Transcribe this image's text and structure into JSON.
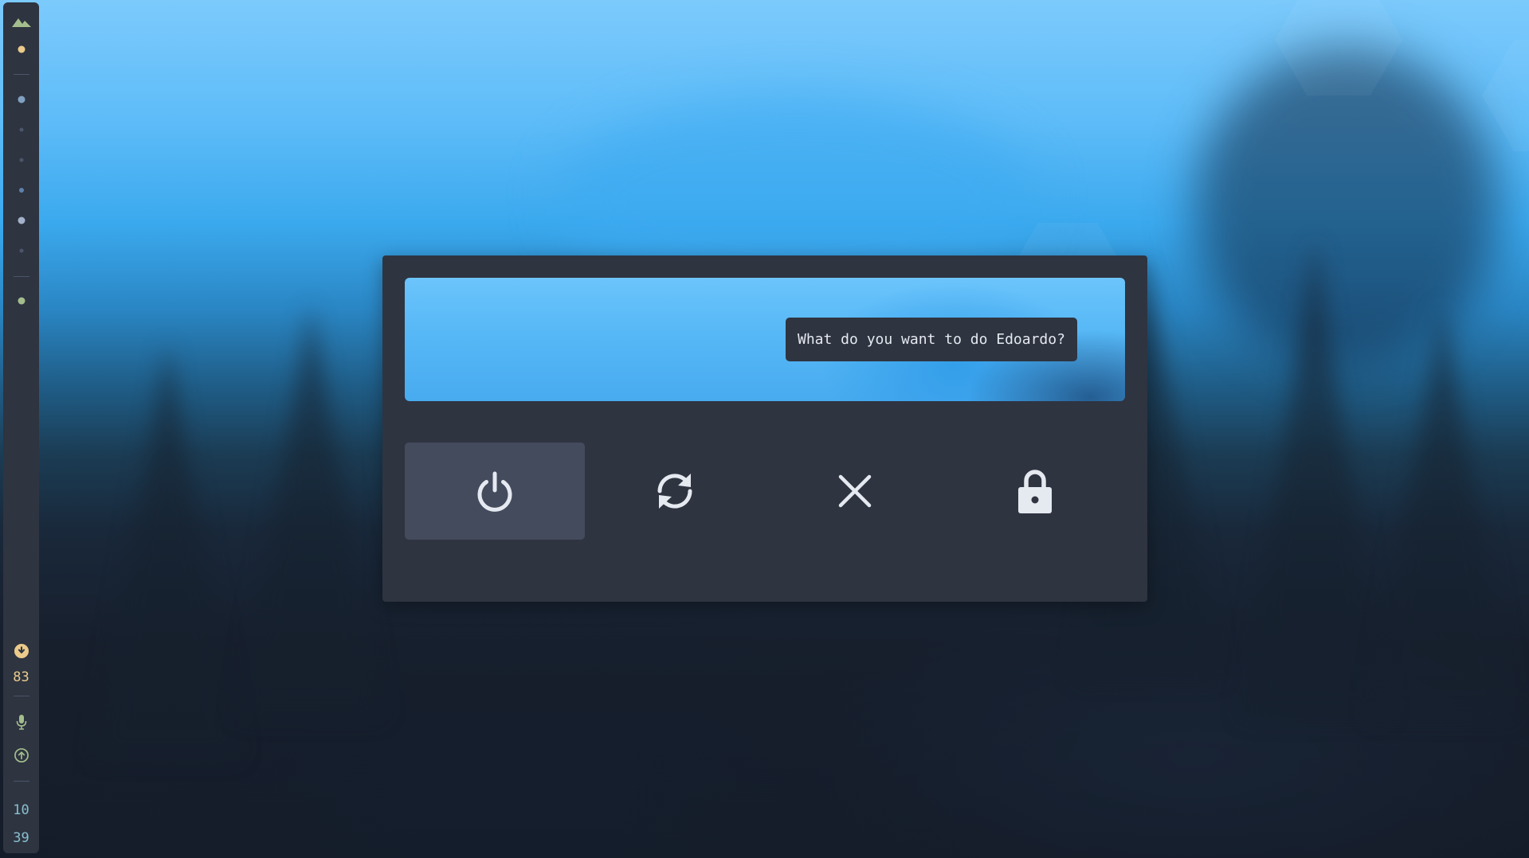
{
  "colors": {
    "panel": "#2e3440",
    "menu_bg": "#2f3441",
    "selected_bg": "#444b5d",
    "icon": "#e5e9f0",
    "yellow": "#ebcb8b",
    "green": "#a3be8c",
    "blue_dot": "#81a1c1",
    "clock": "#88c0d0",
    "separator": "#4c566a"
  },
  "sidebar": {
    "logo_icon": "mountain-icon",
    "battery_percent": "83",
    "battery_icon": "battery-icon",
    "mic_icon": "microphone-icon",
    "update_icon": "arrow-up-circle-icon",
    "clock_hour": "10",
    "clock_minute": "39",
    "workspaces": [
      {
        "state": "active",
        "color": "#ebcb8b"
      },
      {
        "state": "occupied",
        "color": "#81a1c1"
      },
      {
        "state": "empty",
        "color": "#4c566a"
      },
      {
        "state": "empty",
        "color": "#4c566a"
      },
      {
        "state": "urgent-small",
        "color": "#5e81ac"
      },
      {
        "state": "occupied",
        "color": "#a3b1c9"
      },
      {
        "state": "empty",
        "color": "#4c566a"
      },
      {
        "state": "special",
        "color": "#a3be8c"
      }
    ]
  },
  "power_menu": {
    "prompt": "What do you want to do Edoardo?",
    "selected": "shutdown",
    "buttons": [
      {
        "id": "shutdown",
        "icon": "power-icon"
      },
      {
        "id": "reboot",
        "icon": "refresh-icon"
      },
      {
        "id": "logout",
        "icon": "close-icon"
      },
      {
        "id": "lock",
        "icon": "lock-icon"
      }
    ]
  }
}
